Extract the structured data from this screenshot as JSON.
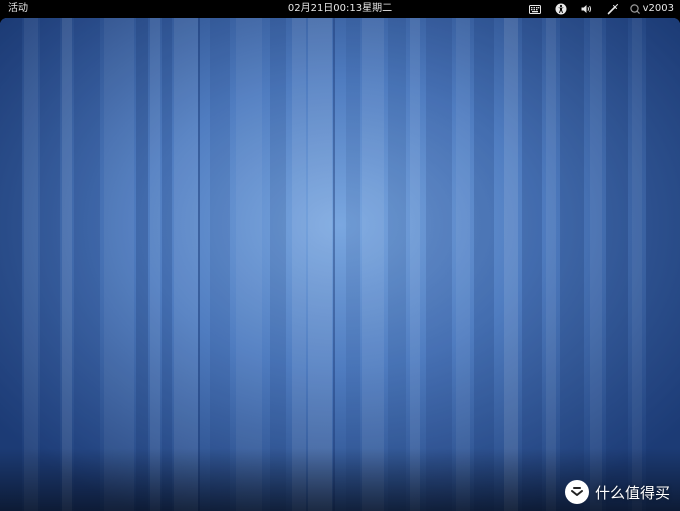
{
  "topbar": {
    "activities_label": "活动",
    "clock": "02月21日00:13星期二",
    "status_icons": [
      "keyboard-icon",
      "accessibility-icon",
      "volume-icon",
      "bluetooth-icon"
    ],
    "user": {
      "icon": "user-status-icon",
      "name": "v2003"
    }
  },
  "watermark": {
    "text": "什么值得买",
    "icon": "smzdm-logo-icon"
  },
  "colors": {
    "topbar_bg": "#000000",
    "topbar_text": "#e8e8e8",
    "wallpaper_base": "#3a63a6",
    "wallpaper_highlight": "#7aa7e0"
  }
}
